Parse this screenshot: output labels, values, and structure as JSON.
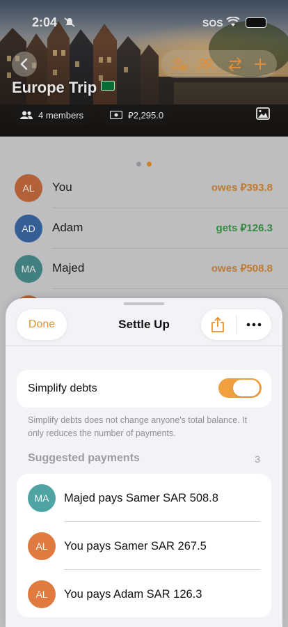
{
  "status_bar": {
    "time": "2:04",
    "sos": "SOS"
  },
  "trip": {
    "title": "Europe Trip",
    "members_chip": "4 members",
    "total_chip": "⃁2,295.0"
  },
  "header_actions": [
    "add-member-icon",
    "members-icon",
    "transfer-icon",
    "plus-icon"
  ],
  "members": [
    {
      "initials": "AL",
      "name": "You",
      "amount": "owes ⃁393.8",
      "color": "#d9773f",
      "amount_color": "#e0903a"
    },
    {
      "initials": "AD",
      "name": "Adam",
      "amount": "gets ⃁126.3",
      "color": "#3d72b8",
      "amount_color": "#3aa84a"
    },
    {
      "initials": "MA",
      "name": "Majed",
      "amount": "owes ⃁508.8",
      "color": "#4f9a9a",
      "amount_color": "#e0903a"
    }
  ],
  "sheet": {
    "done_label": "Done",
    "title": "Settle Up",
    "simplify_label": "Simplify debts",
    "simplify_on": true,
    "note": "Simplify debts does not change anyone's total balance. It only reduces the number of payments.",
    "section_title": "Suggested payments",
    "section_count": "3",
    "payments": [
      {
        "initials": "MA",
        "text": "Majed pays Samer SAR 508.8",
        "color": "#4fa3a3"
      },
      {
        "initials": "AL",
        "text": "You pays Samer SAR 267.5",
        "color": "#e07a3e"
      },
      {
        "initials": "AL",
        "text": "You pays Adam SAR 126.3",
        "color": "#e07a3e"
      }
    ]
  },
  "colors": {
    "accent": "#e0912e",
    "toggle_on": "#f0a03e"
  }
}
